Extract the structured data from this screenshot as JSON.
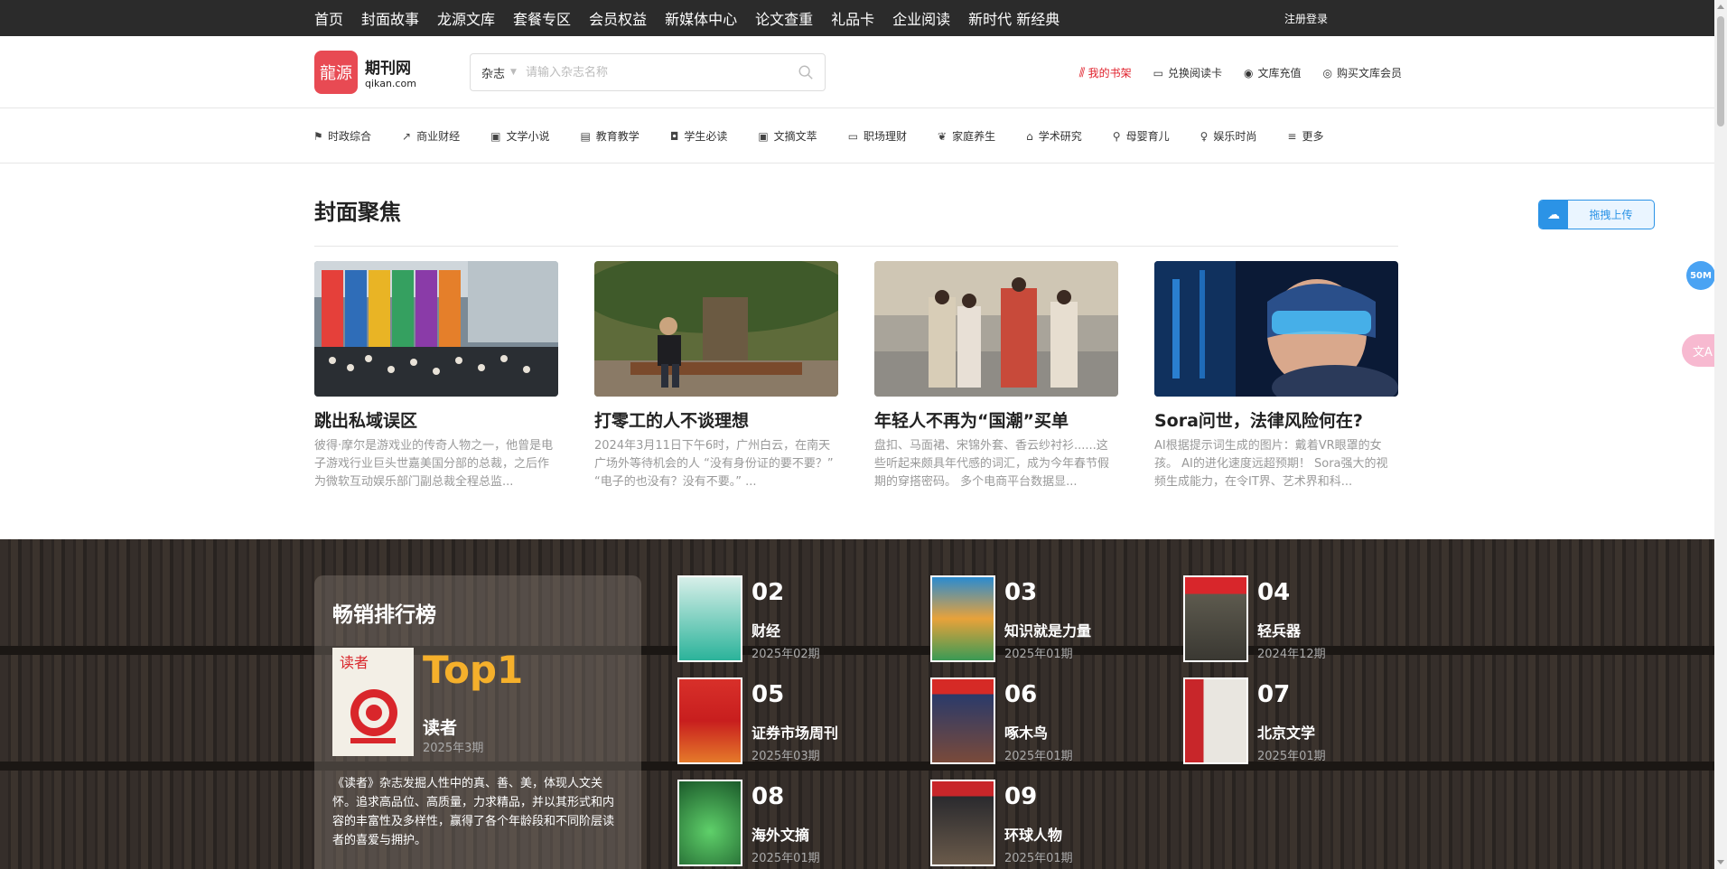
{
  "topnav": [
    "首页",
    "封面故事",
    "龙源文库",
    "套餐专区",
    "会员权益",
    "新媒体中心",
    "论文查重",
    "礼品卡",
    "企业阅读",
    "新时代 新经典"
  ],
  "login": "注册登录",
  "logo": {
    "mark": "龍源",
    "name": "期刊网",
    "domain": "qikan.com"
  },
  "search": {
    "select": "杂志",
    "placeholder": "请输入杂志名称"
  },
  "header_links": {
    "shelf": "我的书架",
    "redeem": "兑换阅读卡",
    "recharge": "文库充值",
    "buy": "购买文库会员"
  },
  "categories": [
    "时政综合",
    "商业财经",
    "文学小说",
    "教育教学",
    "学生必读",
    "文摘文萃",
    "职场理财",
    "家庭养生",
    "学术研究",
    "母婴育儿",
    "娱乐时尚",
    "更多"
  ],
  "focus": {
    "title": "封面聚焦",
    "upload": "拖拽上传",
    "cards": [
      {
        "title": "跳出私域误区",
        "desc": "彼得·摩尔是游戏业的传奇人物之一，他曾是电子游戏行业巨头世嘉美国分部的总裁，之后作为微软互动娱乐部门副总裁全程总监..."
      },
      {
        "title": "打零工的人不谈理想",
        "desc": "2024年3月11日下午6时，广州白云，在南天广场外等待机会的人 “没有身份证的要不要？” “电子的也没有？没有不要。” ..."
      },
      {
        "title": "年轻人不再为“国潮”买单",
        "desc": "盘扣、马面裙、宋锦外套、香云纱衬衫......这些听起来颇具年代感的词汇，成为今年春节假期的穿搭密码。 多个电商平台数据显..."
      },
      {
        "title": "Sora问世，法律风险何在?",
        "desc": "AI根据提示词生成的图片：戴着VR眼罩的女孩。 AI的进化速度远超预期！ Sora强大的视频生成能力，在令IT界、艺术界和科..."
      }
    ]
  },
  "ranking": {
    "title": "畅销排行榜",
    "top1": {
      "label": "Top1",
      "name": "读者",
      "issue": "2025年3期",
      "desc": "《读者》杂志发掘人性中的真、善、美，体现人文关怀。追求高品位、高质量，力求精品，并以其形式和内容的丰富性及多样性，赢得了各个年龄段和不同阶层读者的喜爱与拥护。",
      "cover_title": "读者"
    },
    "items": [
      {
        "num": "02",
        "name": "财经",
        "issue": "2025年02期"
      },
      {
        "num": "03",
        "name": "知识就是力量",
        "issue": "2025年01期"
      },
      {
        "num": "04",
        "name": "轻兵器",
        "issue": "2024年12期"
      },
      {
        "num": "05",
        "name": "证券市场周刊",
        "issue": "2025年03期"
      },
      {
        "num": "06",
        "name": "啄木鸟",
        "issue": "2025年01期"
      },
      {
        "num": "07",
        "name": "北京文学",
        "issue": "2025年01期"
      },
      {
        "num": "08",
        "name": "海外文摘",
        "issue": "2025年01期"
      },
      {
        "num": "09",
        "name": "环球人物",
        "issue": "2025年01期"
      }
    ]
  },
  "floaters": {
    "badge": "50M"
  },
  "colors": {
    "accent_red": "#e0202b",
    "top1_gold": "#f5b02b",
    "upload_blue": "#2b93e6",
    "topbar": "#2b2b2b"
  }
}
